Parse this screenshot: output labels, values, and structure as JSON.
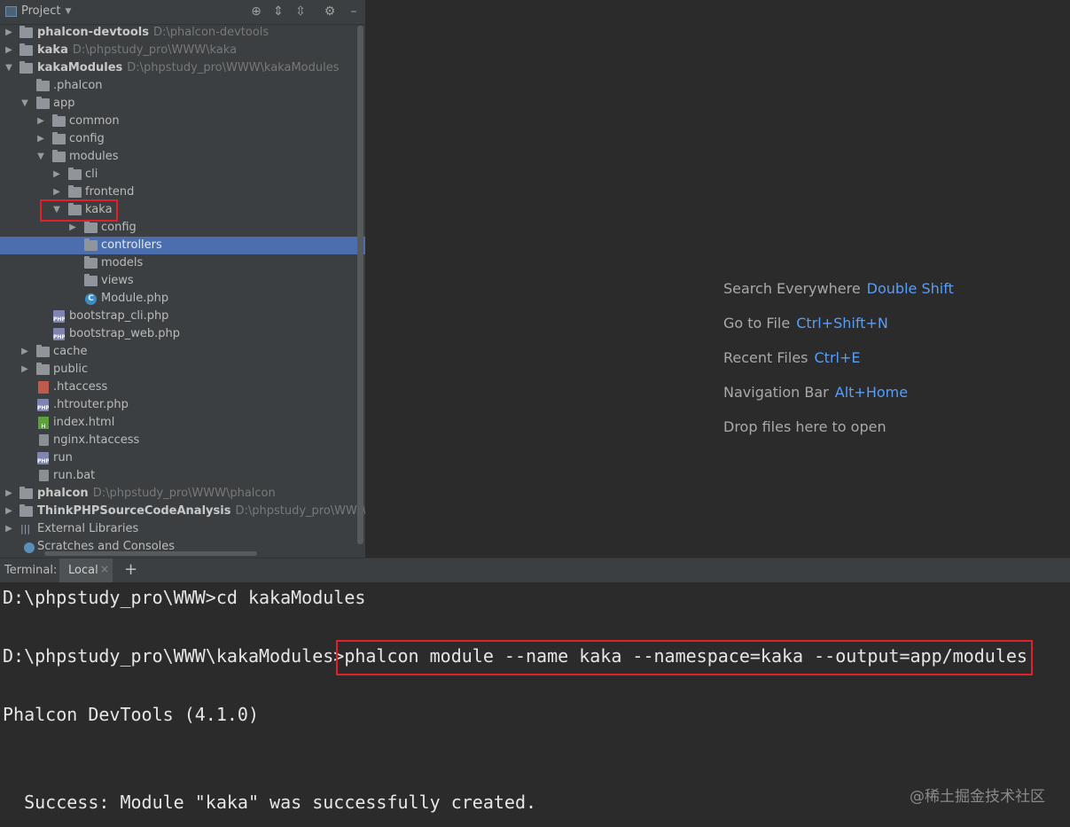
{
  "project_header": {
    "title": "Project"
  },
  "tree": [
    {
      "label": "phalcon-devtools",
      "path": "D:\\phalcon-devtools"
    },
    {
      "label": "kaka",
      "path": "D:\\phpstudy_pro\\WWW\\kaka"
    },
    {
      "label": "kakaModules",
      "path": "D:\\phpstudy_pro\\WWW\\kakaModules"
    },
    {
      "label": ".phalcon"
    },
    {
      "label": "app"
    },
    {
      "label": "common"
    },
    {
      "label": "config"
    },
    {
      "label": "modules"
    },
    {
      "label": "cli"
    },
    {
      "label": "frontend"
    },
    {
      "label": "kaka"
    },
    {
      "label": "config"
    },
    {
      "label": "controllers"
    },
    {
      "label": "models"
    },
    {
      "label": "views"
    },
    {
      "label": "Module.php"
    },
    {
      "label": "bootstrap_cli.php"
    },
    {
      "label": "bootstrap_web.php"
    },
    {
      "label": "cache"
    },
    {
      "label": "public"
    },
    {
      "label": ".htaccess"
    },
    {
      "label": ".htrouter.php"
    },
    {
      "label": "index.html"
    },
    {
      "label": "nginx.htaccess"
    },
    {
      "label": "run"
    },
    {
      "label": "run.bat"
    },
    {
      "label": "phalcon",
      "path": "D:\\phpstudy_pro\\WWW\\phalcon"
    },
    {
      "label": "ThinkPHPSourceCodeAnalysis",
      "path": "D:\\phpstudy_pro\\WWW\\ThinkP"
    },
    {
      "label": "External Libraries"
    },
    {
      "label": "Scratches and Consoles"
    }
  ],
  "editor_hints": [
    {
      "text": "Search Everywhere",
      "key": "Double Shift"
    },
    {
      "text": "Go to File",
      "key": "Ctrl+Shift+N"
    },
    {
      "text": "Recent Files",
      "key": "Ctrl+E"
    },
    {
      "text": "Navigation Bar",
      "key": "Alt+Home"
    },
    {
      "text": "Drop files here to open",
      "key": ""
    }
  ],
  "terminal": {
    "title": "Terminal:",
    "tab": "Local",
    "lines": [
      "D:\\phpstudy_pro\\WWW>cd kakaModules",
      "D:\\phpstudy_pro\\WWW\\kakaModules>phalcon module --name kaka --namespace=kaka --output=app/modules",
      "Phalcon DevTools (4.1.0)",
      "  Success: Module \"kaka\" was successfully created."
    ]
  },
  "watermark": "@稀土掘金技术社区",
  "colors": {
    "accent": "#589df6",
    "selection": "#4b6eaf",
    "highlight_box": "#e0202a"
  }
}
